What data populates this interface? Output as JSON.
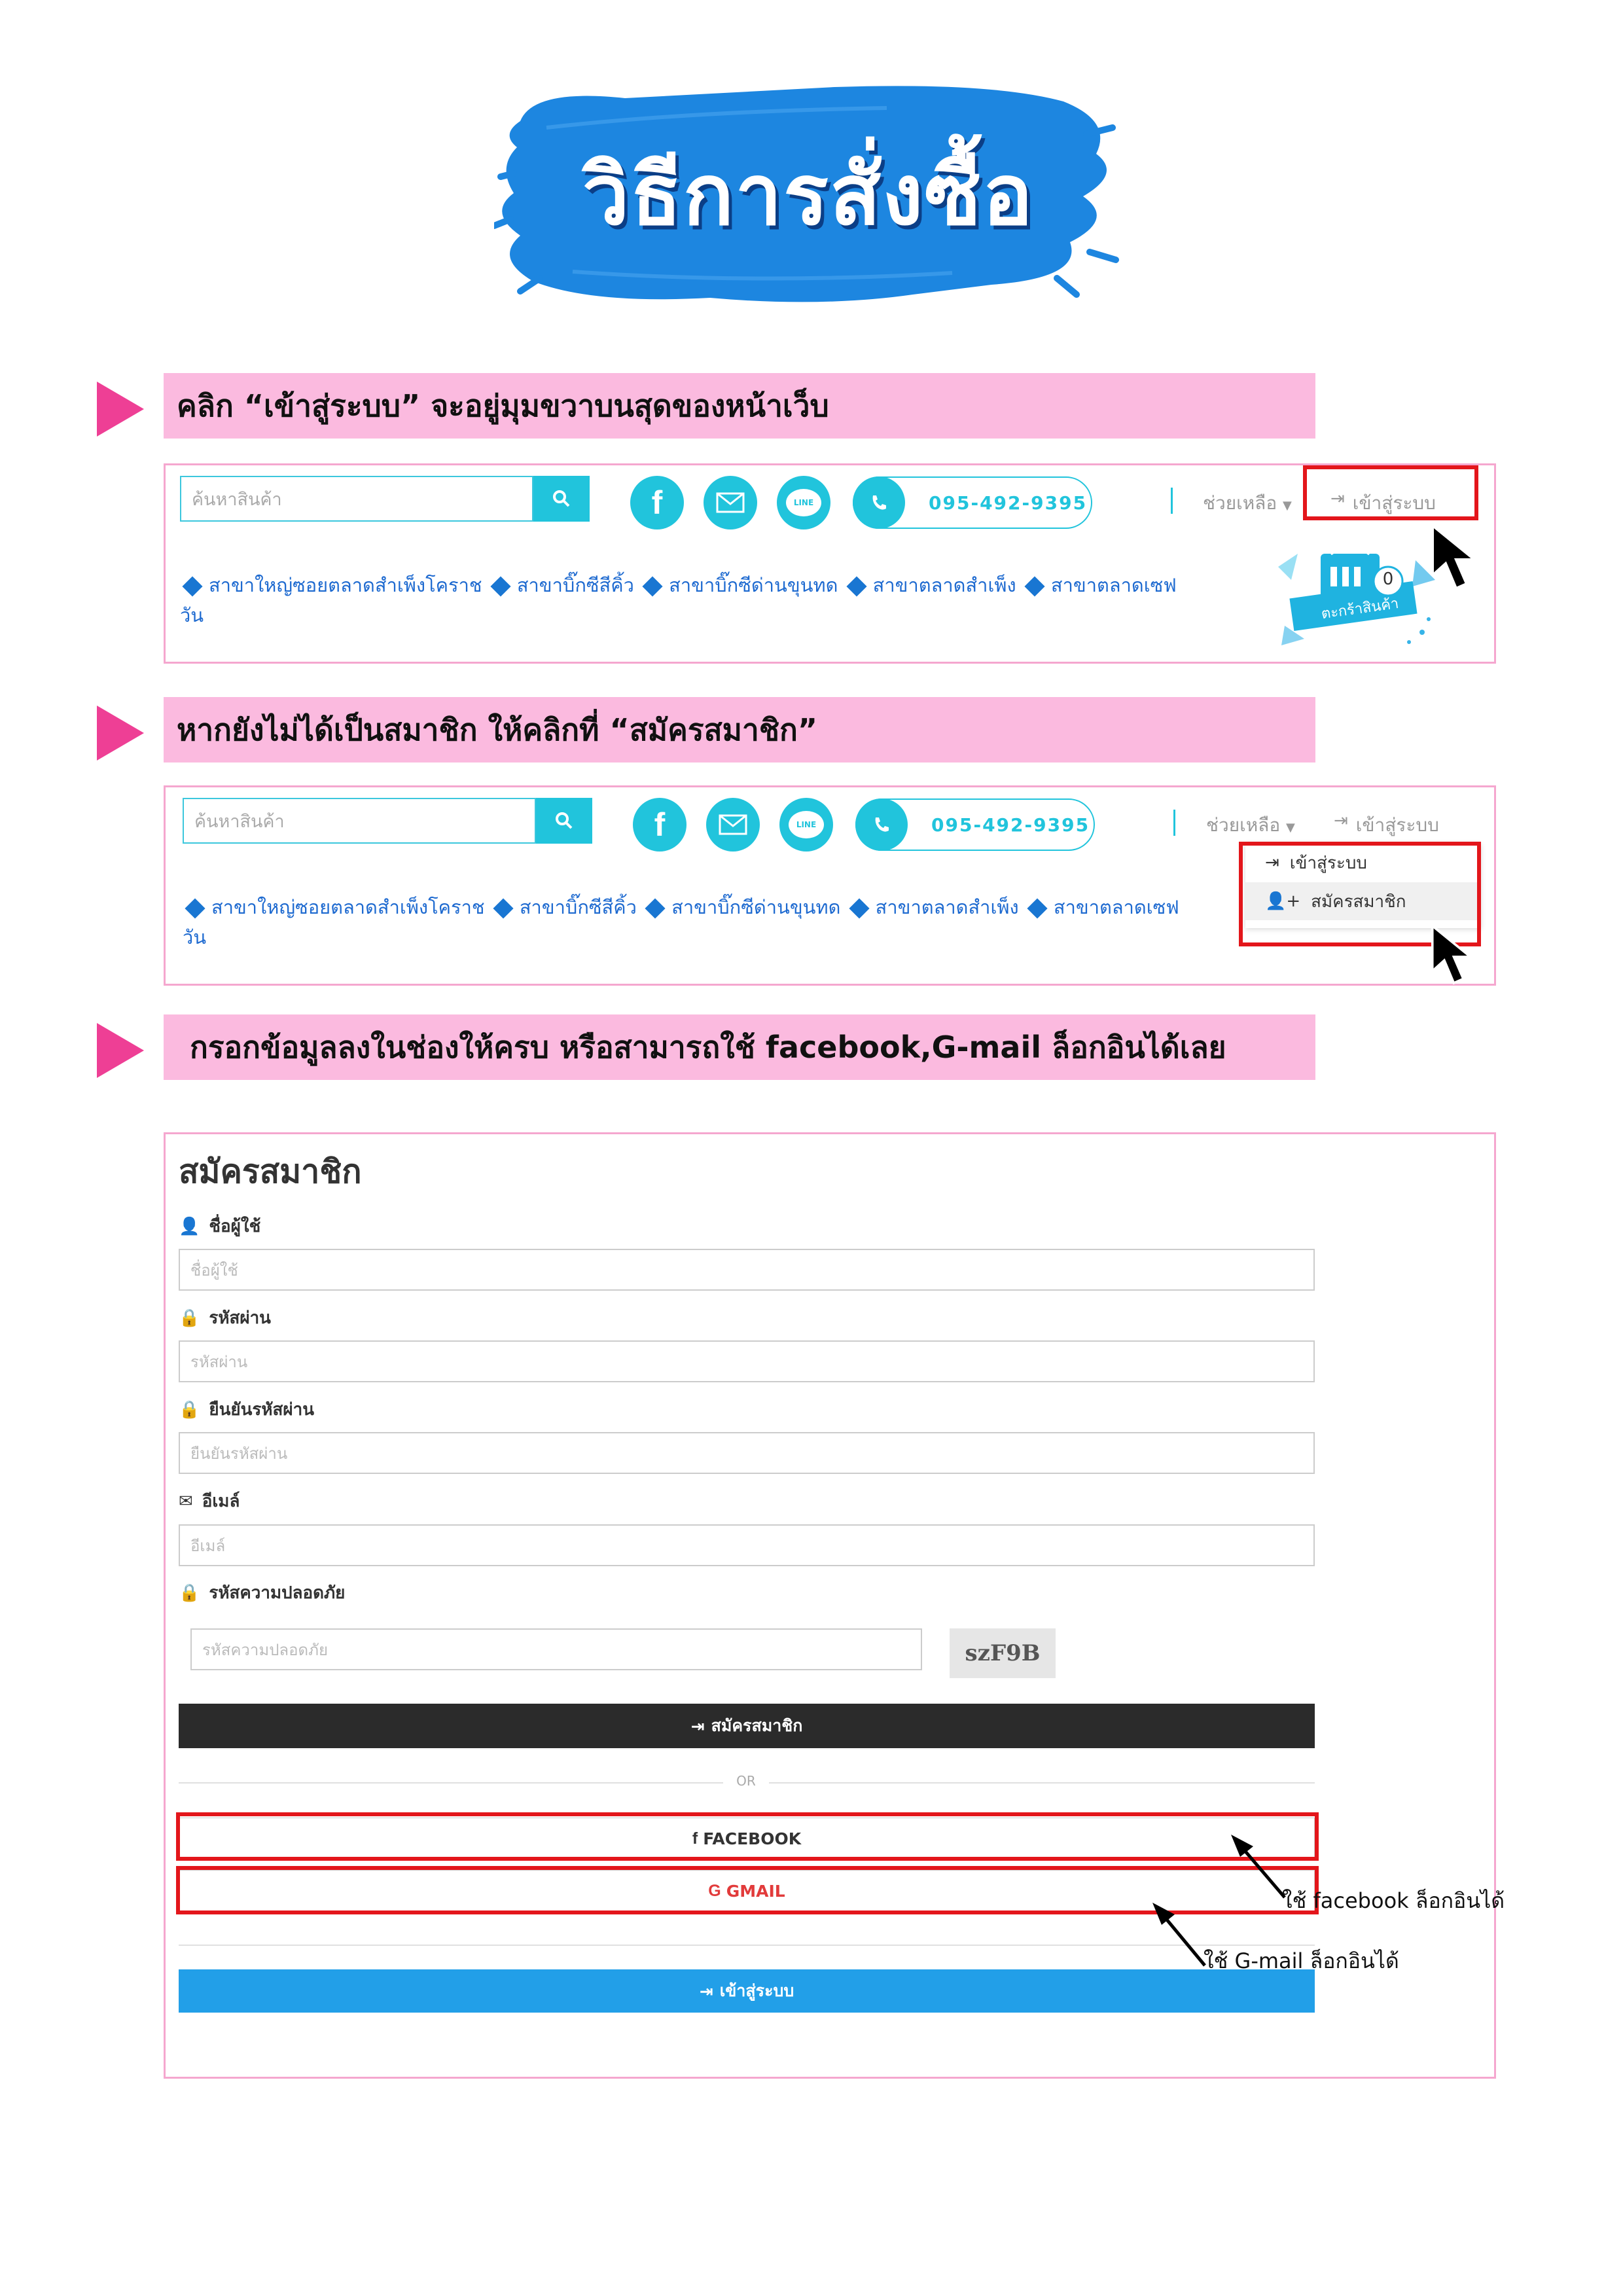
{
  "title": "วิธีการสั่งซื้อ",
  "steps": [
    {
      "text": "คลิก “เข้าสู่ระบบ” จะอยู่มุมขวาบนสุดของหน้าเว็บ"
    },
    {
      "text": "หากยังไม่ได้เป็นสมาชิก ให้คลิกที่ “สมัครสมาชิก”"
    },
    {
      "text": "กรอกข้อมูลลงในช่องให้ครบ หรือสามารถใช้ facebook,G-mail ล็อกอินได้เลย"
    }
  ],
  "header": {
    "search_placeholder": "ค้นหาสินค้า",
    "phone": "095-492-9395",
    "line_label": "LINE",
    "help": "ช่วยเหลือ",
    "login": "เข้าสู่ระบบ",
    "cart_count": "0",
    "cart_label": "ตะกร้าสินค้า",
    "branches": [
      "สาขาใหญ่ซอยตลาดสำเพ็งโคราช",
      "สาขาบิ๊กซีสีคิ้ว",
      "สาขาบิ๊กซีด่านขุนทด",
      "สาขาตลาดสำเพ็ง",
      "สาขาตลาดเซฟ"
    ],
    "branches_wrap": "วัน"
  },
  "dropdown": {
    "login": "เข้าสู่ระบบ",
    "register": "สมัครสมาชิก"
  },
  "form": {
    "title": "สมัครสมาชิก",
    "username_label": "ชื่อผู้ใช้",
    "username_ph": "ชื่อผู้ใช้",
    "password_label": "รหัสผ่าน",
    "password_ph": "รหัสผ่าน",
    "confirm_label": "ยืนยันรหัสผ่าน",
    "confirm_ph": "ยืนยันรหัสผ่าน",
    "email_label": "อีเมล์",
    "email_ph": "อีเมล์",
    "captcha_label": "รหัสความปลอดภัย",
    "captcha_ph": "รหัสความปลอดภัย",
    "captcha_code": "szF9B",
    "register_btn": "สมัครสมาชิก",
    "or": "OR",
    "facebook_btn": "FACEBOOK",
    "gmail_btn": "GMAIL",
    "login_btn": "เข้าสู่ระบบ"
  },
  "notes": {
    "facebook": "ใช้ facebook ล็อกอินได้",
    "gmail": "ใช้ G-mail ล็อกอินได้"
  },
  "colors": {
    "brush": "#1d86e0",
    "cyan": "#21c4dc",
    "pink": "#fbbadf",
    "magenta": "#ee3f95",
    "red": "#e3161b",
    "dark": "#2b2b2b",
    "blue": "#229fe8"
  }
}
